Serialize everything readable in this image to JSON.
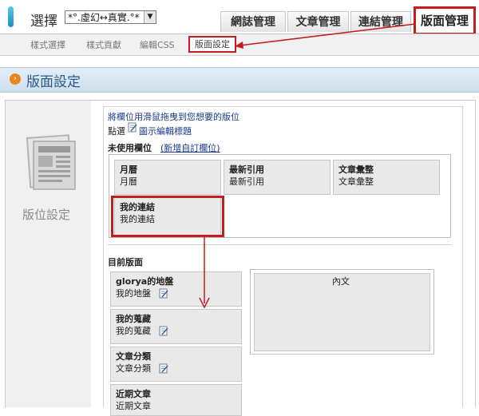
{
  "header": {
    "brand": "選擇",
    "blog_select_value": "*°.虛幻↔真實.°*",
    "tabs": [
      "網誌管理",
      "文章管理",
      "連結管理",
      "版面管理"
    ]
  },
  "subnav": [
    "樣式選擇",
    "樣式貢獻",
    "編輯CSS",
    "版面設定"
  ],
  "section_title": "版面設定",
  "sidebar_label": "版位設定",
  "instructions": {
    "hint": "將欄位用滑鼠拖曳到您想要的版位",
    "click_prefix": "點選",
    "click_suffix": "圖示編輯標題"
  },
  "unused": {
    "label": "未使用欄位",
    "add_link": "(新增自訂欄位)",
    "blocks": [
      {
        "title": "月曆",
        "sub": "月曆"
      },
      {
        "title": "最新引用",
        "sub": "最新引用"
      },
      {
        "title": "文章彙整",
        "sub": "文章彙整"
      },
      {
        "title": "我的連結",
        "sub": "我的連結"
      }
    ]
  },
  "current": {
    "label": "目前版面",
    "blocks": [
      {
        "title": "glorya的地盤",
        "sub": "我的地盤"
      },
      {
        "title": "我的蒐藏",
        "sub": "我的蒐藏"
      },
      {
        "title": "文章分類",
        "sub": "文章分類"
      },
      {
        "title": "近期文章",
        "sub": "近期文章"
      }
    ],
    "main": "內文"
  },
  "colors": {
    "accent": "#c31d1d",
    "section_bar": "#cfdfee",
    "title_blue": "#2a5a88"
  }
}
